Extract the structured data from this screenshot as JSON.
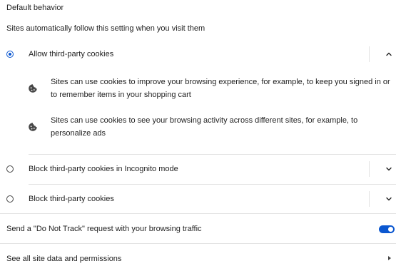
{
  "section": {
    "title": "Default behavior",
    "subtitle": "Sites automatically follow this setting when you visit them"
  },
  "options": [
    {
      "label": "Allow third-party cookies",
      "selected": true,
      "expanded": true,
      "details": [
        {
          "icon": "cookie-icon",
          "text": "Sites can use cookies to improve your browsing experience, for example, to keep you signed in or to remember items in your shopping cart"
        },
        {
          "icon": "cookie-icon",
          "text": "Sites can use cookies to see your browsing activity across different sites, for example, to personalize ads"
        }
      ]
    },
    {
      "label": "Block third-party cookies in Incognito mode",
      "selected": false,
      "expanded": false
    },
    {
      "label": "Block third-party cookies",
      "selected": false,
      "expanded": false
    }
  ],
  "do_not_track": {
    "label": "Send a \"Do Not Track\" request with your browsing traffic",
    "enabled": true
  },
  "site_data_link": {
    "label": "See all site data and permissions"
  },
  "colors": {
    "accent": "#0b57d0",
    "text": "#1f1f1f",
    "divider": "#e3e3e3"
  }
}
